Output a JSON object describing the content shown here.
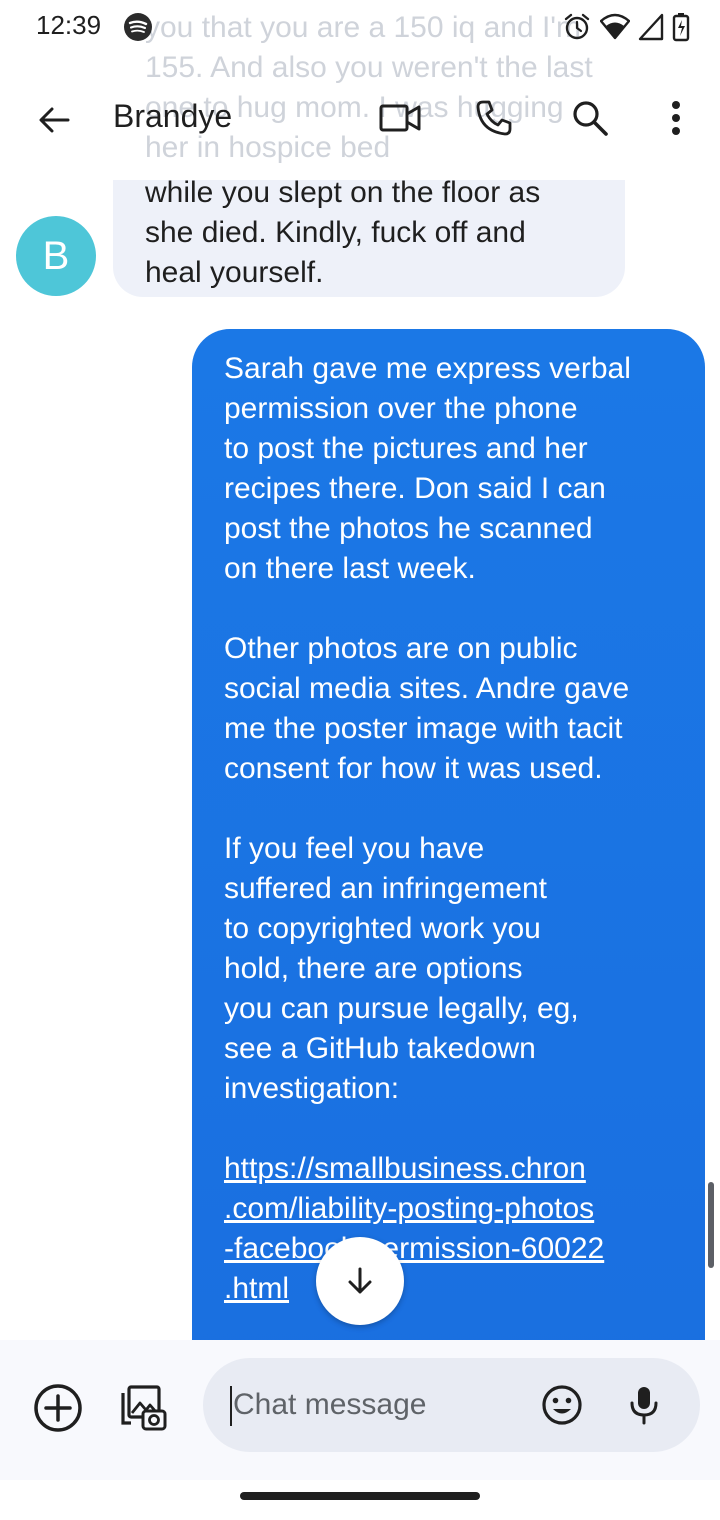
{
  "status_bar": {
    "time": "12:39",
    "icons": [
      "spotify-icon",
      "alarm-icon",
      "wifi-icon",
      "signal-icon",
      "battery-icon"
    ]
  },
  "ghost_text": "you that you are a 150 iq and I'm 155. And also you weren't the last one to hug mom. I was hugging her in hospice bed",
  "header": {
    "contact_name": "Brandye",
    "icons": [
      "back-arrow-icon",
      "video-call-icon",
      "phone-icon",
      "search-icon",
      "more-vert-icon"
    ]
  },
  "messages": {
    "incoming": {
      "avatar_initial": "B",
      "avatar_color": "#4ec6d8",
      "text": "while you slept on the floor as\nshe died. Kindly, fuck off and\nheal yourself."
    },
    "outgoing": {
      "bubble_color": "#1a73e8",
      "paragraphs": [
        "Sarah gave me express verbal\npermission over the phone\nto post the pictures and her\nrecipes there. Don said I can\npost the photos he scanned\non there last week.",
        "Other photos are on public\nsocial media sites. Andre gave\nme the poster image with tacit\nconsent for how it was used.",
        "If you feel you have\nsuffered an infringement\nto copyrighted work you\nhold, there are options\nyou can pursue legally, eg,\nsee a GitHub takedown\ninvestigation:"
      ],
      "link": "https://smallbusiness.chron\n.com/liability-posting-photos\n-facebook-permission-60022\n.html"
    }
  },
  "composer": {
    "placeholder": "Chat message",
    "value": "",
    "icons": [
      "add-circle-icon",
      "gallery-icon",
      "emoji-icon",
      "mic-icon"
    ]
  },
  "scroll_down_icon": "arrow-down-icon"
}
